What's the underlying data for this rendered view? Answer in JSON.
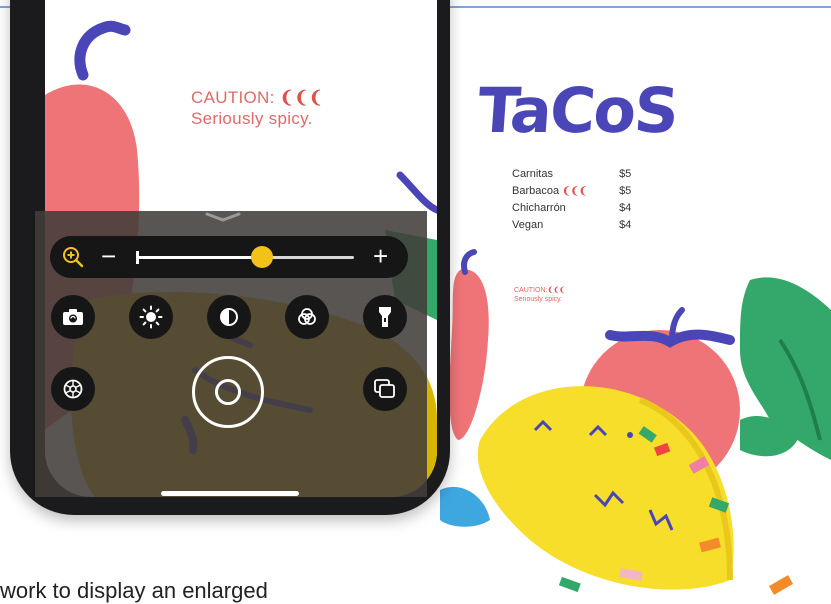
{
  "screen_text": {
    "caution_line1": "CAUTION:",
    "caution_peppers": "❨❨❨",
    "caution_line2": "Seriously spicy."
  },
  "magnifier": {
    "zoom_minus": "−",
    "zoom_plus": "+",
    "zoom_level_fraction": 0.58,
    "accent_color": "#f2c21b",
    "icons": [
      "zoom-icon",
      "camera-switch-icon",
      "brightness-icon",
      "contrast-icon",
      "filters-icon",
      "flashlight-icon",
      "settings-icon",
      "shutter-button",
      "multi-image-icon"
    ]
  },
  "poster": {
    "title": "TaCoS",
    "menu": [
      {
        "name": "Carnitas",
        "price": "$5"
      },
      {
        "name": "Barbacoa",
        "price": "$5",
        "peppers": "❨❨❨"
      },
      {
        "name": "Chicharrón",
        "price": "$4"
      },
      {
        "name": "Vegan",
        "price": "$4"
      }
    ],
    "caution_line1": "CAUTION:",
    "caution_peppers": "❨❨❨",
    "caution_line2": "Seriously spicy."
  },
  "caption": "work to display an enlarged"
}
